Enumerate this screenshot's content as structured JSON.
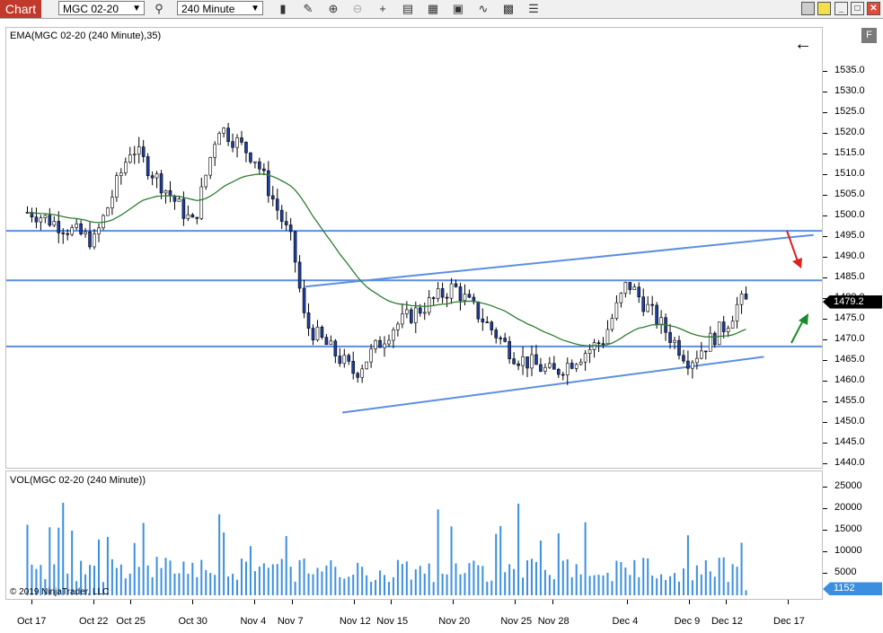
{
  "toolbar": {
    "tab_label": "Chart",
    "instrument": "MGC 02-20",
    "interval": "240 Minute"
  },
  "price_panel": {
    "title": "EMA(MGC 02-20 (240 Minute),35)",
    "current_price": "1479.2",
    "axis_ticks": [
      "1535.0",
      "1530.0",
      "1525.0",
      "1520.0",
      "1515.0",
      "1510.0",
      "1505.0",
      "1500.0",
      "1495.0",
      "1490.0",
      "1485.0",
      "1480.0",
      "1475.0",
      "1470.0",
      "1465.0",
      "1460.0",
      "1455.0",
      "1450.0",
      "1445.0",
      "1440.0"
    ]
  },
  "volume_panel": {
    "title": "VOL(MGC 02-20 (240 Minute))",
    "current_volume": "1152",
    "axis_ticks": [
      "25000",
      "20000",
      "15000",
      "10000",
      "5000"
    ]
  },
  "time_axis": {
    "labels": [
      "Oct 17",
      "Oct 22",
      "Oct 25",
      "Oct 30",
      "Nov 4",
      "Nov 7",
      "Nov 12",
      "Nov 15",
      "Nov 20",
      "Nov 25",
      "Nov 28",
      "Dec 4",
      "Dec 9",
      "Dec 12",
      "Dec 17"
    ]
  },
  "copyright": "© 2019 NinjaTrader, LLC",
  "colors": {
    "candle_up": "#ffffff",
    "candle_down": "#1f3fa0",
    "ema": "#2e7d32",
    "trendline": "#5b8fe0",
    "volume_bar": "#3c8fe0",
    "price_tag": "#000000",
    "volume_tag": "#3c8fe0",
    "arrow_down": "#e02020",
    "arrow_up": "#1a8a2a"
  },
  "chart_data": {
    "type": "candlestick",
    "instrument": "MGC 02-20",
    "interval": "240 Minute",
    "x_range": [
      "Oct 16",
      "Dec 18"
    ],
    "ylim": [
      1437.5,
      1540.0
    ],
    "ema_period": 35,
    "last_price": 1479.2,
    "last_volume": 1152,
    "horizontal_lines": [
      1496.5,
      1484.5,
      1468.5
    ],
    "trendlines": [
      {
        "from": [
          "Nov 8",
          1483.0
        ],
        "to": [
          "Dec 19",
          1495.5
        ]
      },
      {
        "from": [
          "Nov 11",
          1452.5
        ],
        "to": [
          "Dec 15",
          1466.0
        ]
      }
    ],
    "candles_key_points": [
      {
        "date": "Oct 17",
        "close": 1501.0
      },
      {
        "date": "Oct 22",
        "close": 1494.0
      },
      {
        "date": "Oct 25",
        "close": 1517.0
      },
      {
        "date": "Oct 30",
        "close": 1498.0
      },
      {
        "date": "Nov 1",
        "close": 1522.0
      },
      {
        "date": "Nov 4",
        "close": 1514.0
      },
      {
        "date": "Nov 7",
        "close": 1493.0
      },
      {
        "date": "Nov 8",
        "close": 1474.0
      },
      {
        "date": "Nov 12",
        "close": 1462.0
      },
      {
        "date": "Nov 15",
        "close": 1473.0
      },
      {
        "date": "Nov 20",
        "close": 1483.0
      },
      {
        "date": "Nov 25",
        "close": 1466.0
      },
      {
        "date": "Nov 28",
        "close": 1462.0
      },
      {
        "date": "Dec 2",
        "close": 1470.0
      },
      {
        "date": "Dec 4",
        "close": 1484.0
      },
      {
        "date": "Dec 9",
        "close": 1465.0
      },
      {
        "date": "Dec 12",
        "close": 1474.0
      },
      {
        "date": "Dec 13",
        "close": 1479.2
      }
    ],
    "volume_ylim": [
      0,
      28000
    ]
  }
}
